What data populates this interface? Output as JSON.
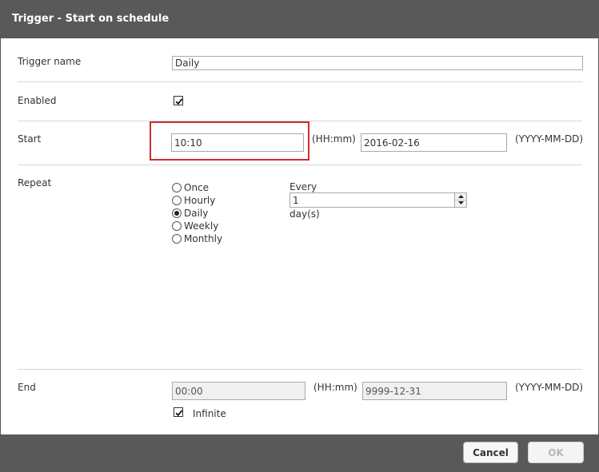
{
  "dialog": {
    "title": "Trigger - Start on schedule"
  },
  "trigger_name": {
    "label": "Trigger name",
    "value": "Daily"
  },
  "enabled": {
    "label": "Enabled",
    "checked": true
  },
  "start": {
    "label": "Start",
    "time_value": "10:10",
    "time_hint": "(HH:mm)",
    "date_value": "2016-02-16",
    "date_hint": "(YYYY-MM-DD)"
  },
  "repeat": {
    "label": "Repeat",
    "options": [
      {
        "label": "Once",
        "checked": false
      },
      {
        "label": "Hourly",
        "checked": false
      },
      {
        "label": "Daily",
        "checked": true
      },
      {
        "label": "Weekly",
        "checked": false
      },
      {
        "label": "Monthly",
        "checked": false
      }
    ],
    "every_label": "Every",
    "every_value": "1",
    "unit_label": "day(s)"
  },
  "end": {
    "label": "End",
    "time_value": "00:00",
    "time_hint": "(HH:mm)",
    "date_value": "9999-12-31",
    "date_hint": "(YYYY-MM-DD)",
    "infinite_label": "Infinite",
    "infinite_checked": true
  },
  "footer": {
    "cancel_label": "Cancel",
    "ok_label": "OK"
  },
  "colors": {
    "titlebar": "#595959",
    "highlight": "#d22b2b"
  }
}
